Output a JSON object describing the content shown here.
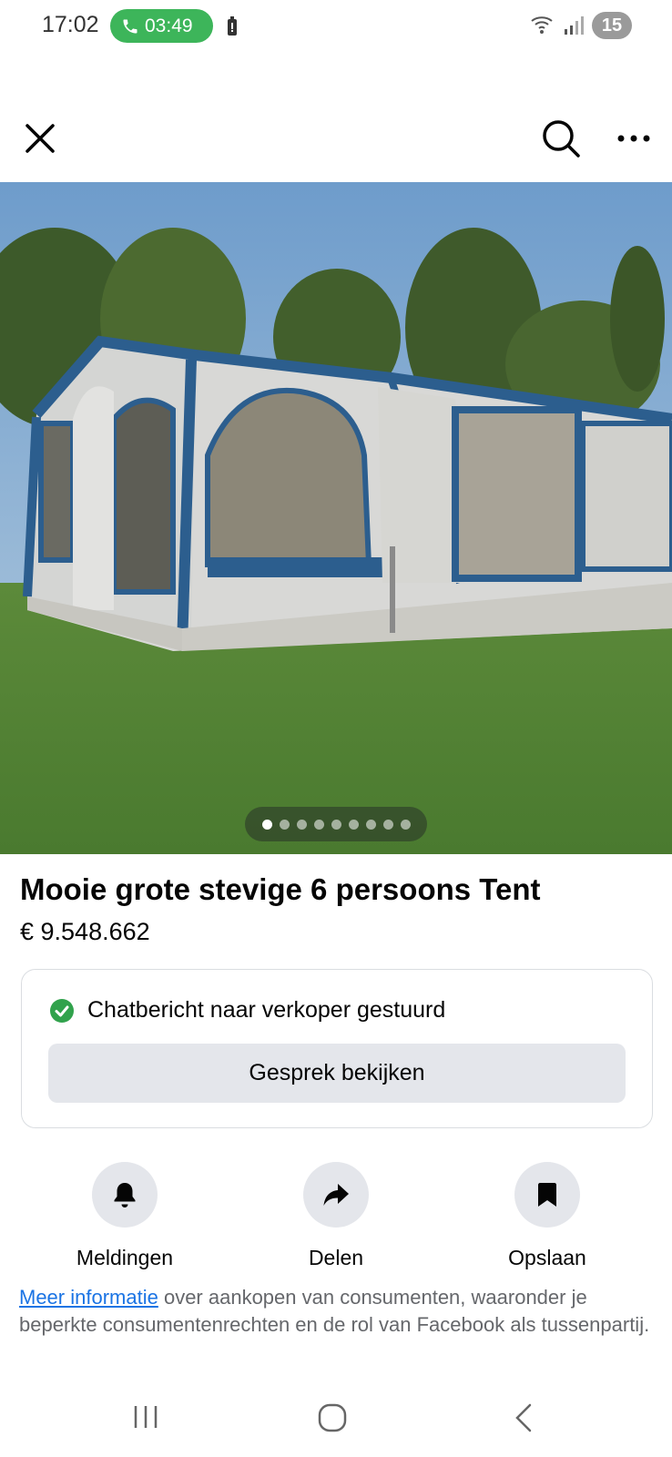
{
  "status_bar": {
    "time": "17:02",
    "call_timer": "03:49",
    "notification_count": "15"
  },
  "top_bar": {
    "close_icon": "close-icon",
    "search_icon": "search-icon",
    "more_icon": "more-icon"
  },
  "carousel": {
    "total_images": 9,
    "active_index": 0
  },
  "listing": {
    "title": "Mooie grote stevige 6 persoons Tent",
    "price": "€ 9.548.662"
  },
  "message_card": {
    "status_text": "Chatbericht naar verkoper gestuurd",
    "view_button_label": "Gesprek bekijken"
  },
  "actions": [
    {
      "label": "Meldingen",
      "icon": "bell-icon"
    },
    {
      "label": "Delen",
      "icon": "share-arrow-icon"
    },
    {
      "label": "Opslaan",
      "icon": "bookmark-icon"
    }
  ],
  "info": {
    "link_text": "Meer informatie",
    "rest_text": " over aankopen van consumenten, waaronder je beperkte consumentenrechten en de rol van Facebook als tussenpartij."
  },
  "colors": {
    "call_green": "#3db55a",
    "check_green": "#31a24c",
    "link_blue": "#1b74e4",
    "button_gray": "#e4e6eb"
  }
}
